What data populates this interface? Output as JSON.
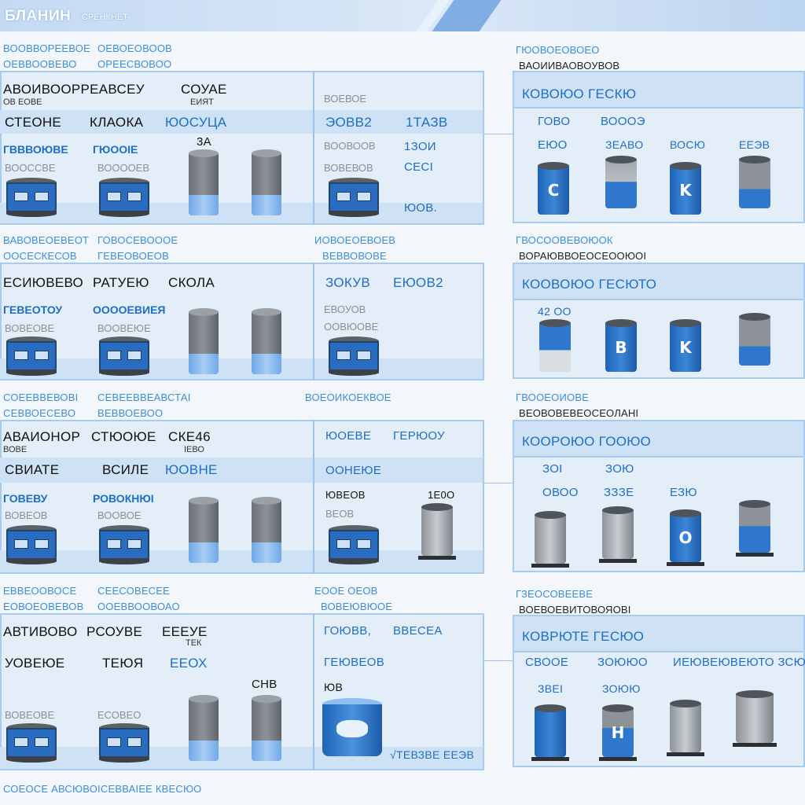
{
  "header": {
    "title": "БЛАНИН",
    "subtitle": "СРЕНКНЕТ"
  },
  "sections": [
    {
      "cap_l1": "ВООВВОРЕЕВОЕ",
      "cap_l2": "ОЕВВООВЕВО",
      "cap_r1": "ОЕВОЕОВООВ",
      "cap_r2": "ОРЕЕСВОВОО",
      "row1": [
        "АВОИВООРРЕАВСЕУ",
        "СОУАЕ"
      ],
      "row1b": [
        "ОВ ЕОВЕ",
        "ЕИЯТ"
      ],
      "row2": [
        "СТЕОНЕ",
        "КЛАОКА",
        "ЮОСУЦА"
      ],
      "row3": [
        "ГВВВОЮВЕ",
        "ГЮООІЕ"
      ],
      "row4": [
        "ВООССВЕ",
        "ВООООЕВ"
      ],
      "num": "3А",
      "mid": {
        "hdr": "ВОЕВОЕ",
        "a": "ЭОВВ2",
        "b": "1ТАЗВ",
        "c1": "ВООВООВ",
        "c2": "1ЗОИ",
        "d1": "ВОВЕВОВ",
        "d2": "СЕСІ",
        "e": "ЮОВ."
      },
      "right": {
        "cap1": "ГЮОВОЕОВОЕО",
        "cap2": "ВАОИИВАОВОУВОВ",
        "hdr": "КОВОЮО ГЕСКЮ",
        "a": "ГОВО",
        "b": "ВОООЭ",
        "c": "ЕЮО",
        "d": "ЗЕАВО",
        "e": "ВОСЮ",
        "f": "ЕЕЭВ"
      }
    },
    {
      "cap_l1": "ВАВОВЕОЕВЕОТ",
      "cap_l2": "ООСЕСКЕСОВ",
      "cap_r1": "ГОВОСЕВОООЕ",
      "cap_r2": "ГЕВЕОВОЕОВ",
      "row1": [
        "ЕСИЮВЕВО",
        "РАТУЕЮ",
        "СКОЛА"
      ],
      "row3": [
        "ГЕВЕОТОУ",
        "ООООЕВИЕЯ"
      ],
      "row4": [
        "ВОВЕОВЕ",
        "ВООВЕЮЕ"
      ],
      "mid": {
        "cap1": "ИОВОЕОЕВОЕВ",
        "cap2": "ВЕВВОВОВЕ",
        "a": "ЗОКУВ",
        "b": "ЕЮОВ2",
        "c1": "ЕВОУОВ",
        "c2": "ООВЮОВЕ"
      },
      "right": {
        "cap1": "ГВОСООВЕВОЮОК",
        "cap2": "ВОРАЮВВОЕОСЕООЮОІ",
        "hdr": "КООВОЮО ГЕСЮТО",
        "a": "42 ОО"
      }
    },
    {
      "cap_l1": "СОЕЕВВЕВОВІ",
      "cap_l2": "СЕВВОЕСЕВО",
      "cap_r1": "СЕВЕЕВВЕАВСТАІ",
      "cap_r2": "ВЕВВОЕВОО",
      "row1": [
        "АВАИОНОР",
        "СТЮОЮЕ",
        "СКЕ46"
      ],
      "row1b": [
        "ВОВЕ",
        "ІЕВО"
      ],
      "row2": [
        "СВИАТЕ",
        "ВСИЛЕ",
        "ЮОВНЕ"
      ],
      "row3": [
        "ГОВЕВУ",
        "РОВОКНЮІ"
      ],
      "row4": [
        "ВОВЕОВ",
        "ВООВОЕ"
      ],
      "mid": {
        "cap1": "ВОЕОИКОЕКВОЕ",
        "a": "ЮОЕВЕ",
        "b": "ГЕРЮОУ",
        "c": "ООНЕЮЕ",
        "d1": "ЮВЕОВ",
        "d2": "1Е0О",
        "e": "ВЕОВ"
      },
      "right": {
        "cap1": "ГВООЕОИОВЕ",
        "cap2": "ВЕОВОВЕВЕОСЕОЛАНІ",
        "hdr": "КООРОЮО ГООЮО",
        "a": "ЗОІ",
        "b": "ЗОЮ",
        "c": "ОВОО",
        "d": "ЗЗЗЕ",
        "e": "ЕЗЮ"
      }
    },
    {
      "cap_l1": "ЕВВЕООВОСЕ",
      "cap_l2": "ЕОВОЕОВЕВОВ",
      "cap_r1": "СЕЕСОВЕСЕЕ",
      "cap_r2": "ООЕВВООВОАО",
      "row1": [
        "АВТИВОВО",
        "РСОУВЕ",
        "ЕЕЕУЕ"
      ],
      "row1b": [
        "",
        "ТЕК"
      ],
      "row2": [
        "УОВЕЮЕ",
        "ТЕЮЯ",
        "ЕЕОХ"
      ],
      "row4": [
        "ВОВЕОВЕ",
        "ЕСОВЕО"
      ],
      "num": "СНВ",
      "mid": {
        "cap1": "ЕООЕ ОЕОВ",
        "cap2": "ВОВЕЮВЮОЕ",
        "a": "ГОЮВВ,",
        "b": "ВВЕСЕА",
        "c": "ГЕЮВЕОВ",
        "d": "ЮВ",
        "e": "√ТЕВЗВЕ ЕЕЭВ"
      },
      "right": {
        "cap1": "ГЗЕОСОВЕЕВЕ",
        "cap2": "ВОЕВОЕВИТОВОЯОВІ",
        "hdr": "КОВРЮТЕ ГЕСЮО",
        "a": "СВООЕ",
        "b": "ЗОЮЮО",
        "c": "ИЕЮВЕЮВЕЮТО ЗСЮО",
        "d": "ЗВЕІ",
        "e": "ЗОЮЮ"
      }
    }
  ],
  "footer": "СОЕОСЕ АВСЮВОІСЕВВАІЕЕ КВЕСЮО"
}
